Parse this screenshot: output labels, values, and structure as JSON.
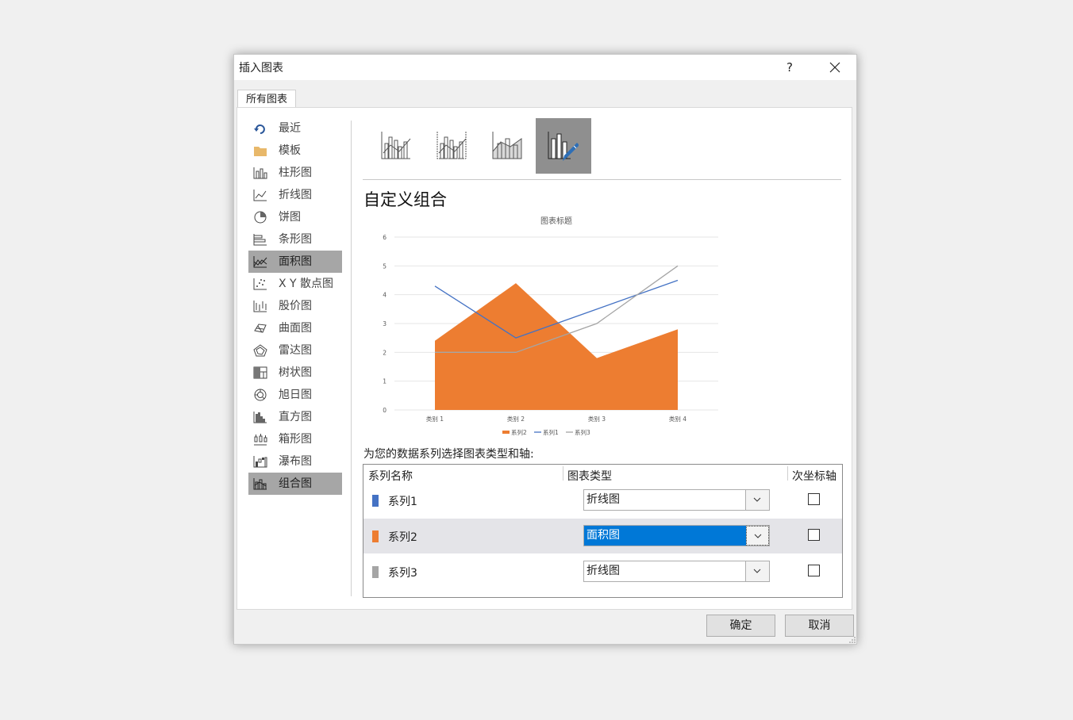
{
  "dialog": {
    "title": "插入图表",
    "help_label": "?"
  },
  "tab": {
    "label": "所有图表"
  },
  "categories": [
    {
      "label": "最近",
      "icon": "recent-icon",
      "selected": false
    },
    {
      "label": "模板",
      "icon": "folder-icon",
      "selected": false
    },
    {
      "label": "柱形图",
      "icon": "column-chart-icon",
      "selected": false
    },
    {
      "label": "折线图",
      "icon": "line-chart-icon",
      "selected": false
    },
    {
      "label": "饼图",
      "icon": "pie-chart-icon",
      "selected": false
    },
    {
      "label": "条形图",
      "icon": "bar-chart-icon",
      "selected": false
    },
    {
      "label": "面积图",
      "icon": "area-chart-icon",
      "selected": true
    },
    {
      "label": "X Y 散点图",
      "icon": "scatter-chart-icon",
      "selected": false
    },
    {
      "label": "股价图",
      "icon": "stock-chart-icon",
      "selected": false
    },
    {
      "label": "曲面图",
      "icon": "surface-chart-icon",
      "selected": false
    },
    {
      "label": "雷达图",
      "icon": "radar-chart-icon",
      "selected": false
    },
    {
      "label": "树状图",
      "icon": "treemap-chart-icon",
      "selected": false
    },
    {
      "label": "旭日图",
      "icon": "sunburst-chart-icon",
      "selected": false
    },
    {
      "label": "直方图",
      "icon": "histogram-chart-icon",
      "selected": false
    },
    {
      "label": "箱形图",
      "icon": "boxwhisker-chart-icon",
      "selected": false
    },
    {
      "label": "瀑布图",
      "icon": "waterfall-chart-icon",
      "selected": false
    },
    {
      "label": "组合图",
      "icon": "combo-chart-icon",
      "selected": true
    }
  ],
  "subtypes": [
    {
      "icon": "clustered-column-line-icon",
      "selected": false
    },
    {
      "icon": "clustered-column-line-secondary-icon",
      "selected": false
    },
    {
      "icon": "stacked-area-column-icon",
      "selected": false
    },
    {
      "icon": "custom-combo-icon",
      "selected": true
    }
  ],
  "heading": "自定义组合",
  "chart_data": {
    "type": "area",
    "title": "图表标题",
    "categories": [
      "类别 1",
      "类别 2",
      "类别 3",
      "类别 4"
    ],
    "series": [
      {
        "name": "系列2",
        "type": "area",
        "color": "#ed7d31",
        "values": [
          2.4,
          4.4,
          1.8,
          2.8
        ]
      },
      {
        "name": "系列1",
        "type": "line",
        "color": "#4472c4",
        "values": [
          4.3,
          2.5,
          3.5,
          4.5
        ]
      },
      {
        "name": "系列3",
        "type": "line",
        "color": "#a5a5a5",
        "values": [
          2,
          2,
          3,
          5
        ]
      }
    ],
    "ylim": [
      0,
      6
    ],
    "yticks": [
      "0",
      "1",
      "2",
      "3",
      "4",
      "5",
      "6"
    ],
    "grid": true,
    "legend": "bottom"
  },
  "series_prompt": "为您的数据系列选择图表类型和轴:",
  "table": {
    "headers": {
      "name": "系列名称",
      "type": "图表类型",
      "secondary": "次坐标轴"
    },
    "rows": [
      {
        "name": "系列1",
        "color": "#4472c4",
        "chart_type": "折线图",
        "secondary": false,
        "selected": false
      },
      {
        "name": "系列2",
        "color": "#ed7d31",
        "chart_type": "面积图",
        "secondary": false,
        "selected": true
      },
      {
        "name": "系列3",
        "color": "#a5a5a5",
        "chart_type": "折线图",
        "secondary": false,
        "selected": false
      }
    ]
  },
  "buttons": {
    "ok": "确定",
    "cancel": "取消"
  }
}
